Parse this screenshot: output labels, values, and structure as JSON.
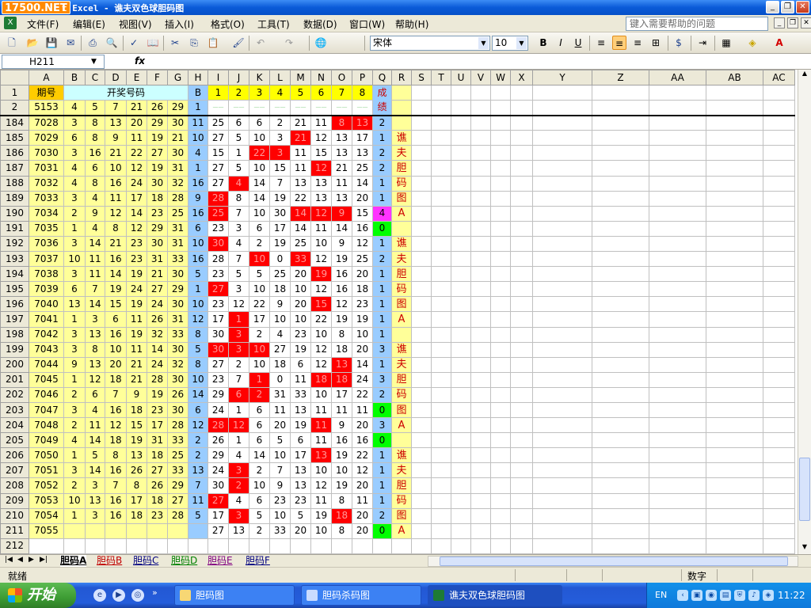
{
  "window": {
    "logo": "17500.NET",
    "title": "t Excel - 谯夫双色球胆码图",
    "controls": [
      "minimize",
      "restore",
      "close"
    ]
  },
  "menu": {
    "items": [
      "文件(F)",
      "编辑(E)",
      "视图(V)",
      "插入(I)",
      "格式(O)",
      "工具(T)",
      "数据(D)",
      "窗口(W)",
      "帮助(H)"
    ],
    "help_placeholder": "键入需要帮助的问题"
  },
  "toolbar": {
    "font_name": "宋体",
    "font_size": "10",
    "bold": "B",
    "italic": "I",
    "underline": "U"
  },
  "formula_bar": {
    "name_box": "H211",
    "fx": "fx",
    "content": ""
  },
  "sheet": {
    "columns": [
      "A",
      "B",
      "C",
      "D",
      "E",
      "F",
      "G",
      "H",
      "I",
      "J",
      "K",
      "L",
      "M",
      "N",
      "O",
      "P",
      "Q",
      "R",
      "S",
      "T",
      "U",
      "V",
      "W",
      "X",
      "Y",
      "Z",
      "AA",
      "AB",
      "AC"
    ],
    "header_row": {
      "row": "1",
      "qihao": "期号",
      "kaijiang": "开奖号码",
      "blue_col": "B",
      "nums": [
        "1",
        "2",
        "3",
        "4",
        "5",
        "6",
        "7",
        "8"
      ],
      "chengji": "成绩"
    },
    "row2": {
      "row": "2",
      "qihao": "5153",
      "balls": [
        "4",
        "5",
        "7",
        "21",
        "26",
        "29"
      ],
      "blue": "1",
      "chengji": "绩"
    },
    "rows": [
      {
        "row": "184",
        "qihao": "7028",
        "balls": [
          "3",
          "8",
          "13",
          "20",
          "29",
          "30"
        ],
        "blue": "11",
        "vals": [
          "25",
          "6",
          "6",
          "2",
          "21",
          "11",
          "8",
          "13"
        ],
        "red": [
          6,
          7
        ],
        "score": "2",
        "score_color": "lb",
        "r": ""
      },
      {
        "row": "185",
        "qihao": "7029",
        "balls": [
          "6",
          "8",
          "9",
          "11",
          "19",
          "21"
        ],
        "blue": "10",
        "vals": [
          "27",
          "5",
          "10",
          "3",
          "21",
          "12",
          "13",
          "17"
        ],
        "red": [
          4
        ],
        "score": "1",
        "score_color": "lb",
        "r": "谯"
      },
      {
        "row": "186",
        "qihao": "7030",
        "balls": [
          "3",
          "16",
          "21",
          "22",
          "27",
          "30"
        ],
        "blue": "4",
        "vals": [
          "15",
          "1",
          "22",
          "3",
          "11",
          "15",
          "13",
          "13"
        ],
        "red": [
          2,
          3
        ],
        "score": "2",
        "score_color": "lb",
        "r": "夫"
      },
      {
        "row": "187",
        "qihao": "7031",
        "balls": [
          "4",
          "6",
          "10",
          "12",
          "19",
          "31"
        ],
        "blue": "1",
        "vals": [
          "27",
          "5",
          "10",
          "15",
          "11",
          "12",
          "21",
          "25"
        ],
        "red": [
          5
        ],
        "score": "2",
        "score_color": "lb",
        "r": "胆"
      },
      {
        "row": "188",
        "qihao": "7032",
        "balls": [
          "4",
          "8",
          "16",
          "24",
          "30",
          "32"
        ],
        "blue": "16",
        "vals": [
          "27",
          "4",
          "14",
          "7",
          "13",
          "13",
          "11",
          "14"
        ],
        "red": [
          1
        ],
        "score": "1",
        "score_color": "lb",
        "r": "码"
      },
      {
        "row": "189",
        "qihao": "7033",
        "balls": [
          "3",
          "4",
          "11",
          "17",
          "18",
          "28"
        ],
        "blue": "9",
        "vals": [
          "28",
          "8",
          "14",
          "19",
          "22",
          "13",
          "13",
          "20"
        ],
        "red": [
          0
        ],
        "score": "1",
        "score_color": "lb",
        "r": "图"
      },
      {
        "row": "190",
        "qihao": "7034",
        "balls": [
          "2",
          "9",
          "12",
          "14",
          "23",
          "25"
        ],
        "blue": "16",
        "vals": [
          "25",
          "7",
          "10",
          "30",
          "14",
          "12",
          "9",
          "15"
        ],
        "red": [
          0,
          4,
          5,
          6
        ],
        "score": "4",
        "score_color": "mag",
        "r": "A"
      },
      {
        "row": "191",
        "qihao": "7035",
        "balls": [
          "1",
          "4",
          "8",
          "12",
          "29",
          "31"
        ],
        "blue": "6",
        "vals": [
          "23",
          "3",
          "6",
          "17",
          "14",
          "11",
          "14",
          "16"
        ],
        "red": [],
        "score": "0",
        "score_color": "grn",
        "r": ""
      },
      {
        "row": "192",
        "qihao": "7036",
        "balls": [
          "3",
          "14",
          "21",
          "23",
          "30",
          "31"
        ],
        "blue": "10",
        "vals": [
          "30",
          "4",
          "2",
          "19",
          "25",
          "10",
          "9",
          "12"
        ],
        "red": [
          0
        ],
        "score": "1",
        "score_color": "lb",
        "r": "谯"
      },
      {
        "row": "193",
        "qihao": "7037",
        "balls": [
          "10",
          "11",
          "16",
          "23",
          "31",
          "33"
        ],
        "blue": "16",
        "vals": [
          "28",
          "7",
          "10",
          "0",
          "33",
          "12",
          "19",
          "25"
        ],
        "red": [
          2,
          4
        ],
        "score": "2",
        "score_color": "lb",
        "r": "夫"
      },
      {
        "row": "194",
        "qihao": "7038",
        "balls": [
          "3",
          "11",
          "14",
          "19",
          "21",
          "30"
        ],
        "blue": "5",
        "vals": [
          "23",
          "5",
          "5",
          "25",
          "20",
          "19",
          "16",
          "20"
        ],
        "red": [
          5
        ],
        "score": "1",
        "score_color": "lb",
        "r": "胆"
      },
      {
        "row": "195",
        "qihao": "7039",
        "balls": [
          "6",
          "7",
          "19",
          "24",
          "27",
          "29"
        ],
        "blue": "1",
        "vals": [
          "27",
          "3",
          "10",
          "18",
          "10",
          "12",
          "16",
          "18"
        ],
        "red": [
          0
        ],
        "score": "1",
        "score_color": "lb",
        "r": "码"
      },
      {
        "row": "196",
        "qihao": "7040",
        "balls": [
          "13",
          "14",
          "15",
          "19",
          "24",
          "30"
        ],
        "blue": "10",
        "vals": [
          "23",
          "12",
          "22",
          "9",
          "20",
          "15",
          "12",
          "23"
        ],
        "red": [
          5
        ],
        "score": "1",
        "score_color": "lb",
        "r": "图"
      },
      {
        "row": "197",
        "qihao": "7041",
        "balls": [
          "1",
          "3",
          "6",
          "11",
          "26",
          "31"
        ],
        "blue": "12",
        "vals": [
          "17",
          "1",
          "17",
          "10",
          "10",
          "22",
          "19",
          "19"
        ],
        "red": [
          1
        ],
        "score": "1",
        "score_color": "lb",
        "r": "A"
      },
      {
        "row": "198",
        "qihao": "7042",
        "balls": [
          "3",
          "13",
          "16",
          "19",
          "32",
          "33"
        ],
        "blue": "8",
        "vals": [
          "30",
          "3",
          "2",
          "4",
          "23",
          "10",
          "8",
          "10"
        ],
        "red": [
          1
        ],
        "score": "1",
        "score_color": "lb",
        "r": ""
      },
      {
        "row": "199",
        "qihao": "7043",
        "balls": [
          "3",
          "8",
          "10",
          "11",
          "14",
          "30"
        ],
        "blue": "5",
        "vals": [
          "30",
          "3",
          "10",
          "27",
          "19",
          "12",
          "18",
          "20"
        ],
        "red": [
          0,
          1,
          2
        ],
        "score": "3",
        "score_color": "lb",
        "r": "谯"
      },
      {
        "row": "200",
        "qihao": "7044",
        "balls": [
          "9",
          "13",
          "20",
          "21",
          "24",
          "32"
        ],
        "blue": "8",
        "vals": [
          "27",
          "2",
          "10",
          "18",
          "6",
          "12",
          "13",
          "14"
        ],
        "red": [
          6
        ],
        "score": "1",
        "score_color": "lb",
        "r": "夫"
      },
      {
        "row": "201",
        "qihao": "7045",
        "balls": [
          "1",
          "12",
          "18",
          "21",
          "28",
          "30"
        ],
        "blue": "10",
        "vals": [
          "23",
          "7",
          "1",
          "0",
          "11",
          "18",
          "18",
          "24"
        ],
        "red": [
          2,
          5,
          6
        ],
        "score": "3",
        "score_color": "lb",
        "r": "胆"
      },
      {
        "row": "202",
        "qihao": "7046",
        "balls": [
          "2",
          "6",
          "7",
          "9",
          "19",
          "26"
        ],
        "blue": "14",
        "vals": [
          "29",
          "6",
          "2",
          "31",
          "33",
          "10",
          "17",
          "22"
        ],
        "red": [
          1,
          2
        ],
        "score": "2",
        "score_color": "lb",
        "r": "码"
      },
      {
        "row": "203",
        "qihao": "7047",
        "balls": [
          "3",
          "4",
          "16",
          "18",
          "23",
          "30"
        ],
        "blue": "6",
        "vals": [
          "24",
          "1",
          "6",
          "11",
          "13",
          "11",
          "11",
          "11"
        ],
        "red": [],
        "score": "0",
        "score_color": "grn",
        "r": "图"
      },
      {
        "row": "204",
        "qihao": "7048",
        "balls": [
          "2",
          "11",
          "12",
          "15",
          "17",
          "28"
        ],
        "blue": "12",
        "vals": [
          "28",
          "12",
          "6",
          "20",
          "19",
          "11",
          "9",
          "20"
        ],
        "red": [
          0,
          1,
          5
        ],
        "score": "3",
        "score_color": "lb",
        "r": "A"
      },
      {
        "row": "205",
        "qihao": "7049",
        "balls": [
          "4",
          "14",
          "18",
          "19",
          "31",
          "33"
        ],
        "blue": "2",
        "vals": [
          "26",
          "1",
          "6",
          "5",
          "6",
          "11",
          "16",
          "16"
        ],
        "red": [],
        "score": "0",
        "score_color": "grn",
        "r": ""
      },
      {
        "row": "206",
        "qihao": "7050",
        "balls": [
          "1",
          "5",
          "8",
          "13",
          "18",
          "25"
        ],
        "blue": "2",
        "vals": [
          "29",
          "4",
          "14",
          "10",
          "17",
          "13",
          "19",
          "22"
        ],
        "red": [
          5
        ],
        "score": "1",
        "score_color": "lb",
        "r": "谯"
      },
      {
        "row": "207",
        "qihao": "7051",
        "balls": [
          "3",
          "14",
          "16",
          "26",
          "27",
          "33"
        ],
        "blue": "13",
        "vals": [
          "24",
          "3",
          "2",
          "7",
          "13",
          "10",
          "10",
          "12"
        ],
        "red": [
          1
        ],
        "score": "1",
        "score_color": "lb",
        "r": "夫"
      },
      {
        "row": "208",
        "qihao": "7052",
        "balls": [
          "2",
          "3",
          "7",
          "8",
          "26",
          "29"
        ],
        "blue": "7",
        "vals": [
          "30",
          "2",
          "10",
          "9",
          "13",
          "12",
          "19",
          "20"
        ],
        "red": [
          1
        ],
        "score": "1",
        "score_color": "lb",
        "r": "胆"
      },
      {
        "row": "209",
        "qihao": "7053",
        "balls": [
          "10",
          "13",
          "16",
          "17",
          "18",
          "27"
        ],
        "blue": "11",
        "vals": [
          "27",
          "4",
          "6",
          "23",
          "23",
          "11",
          "8",
          "11"
        ],
        "red": [
          0
        ],
        "score": "1",
        "score_color": "lb",
        "r": "码"
      },
      {
        "row": "210",
        "qihao": "7054",
        "balls": [
          "1",
          "3",
          "16",
          "18",
          "23",
          "28"
        ],
        "blue": "5",
        "vals": [
          "17",
          "3",
          "5",
          "10",
          "5",
          "19",
          "18",
          "20"
        ],
        "red": [
          1,
          6
        ],
        "score": "2",
        "score_color": "lb",
        "r": "图"
      },
      {
        "row": "211",
        "qihao": "7055",
        "balls": [
          "",
          "",
          "",
          "",
          "",
          ""
        ],
        "blue": "",
        "vals": [
          "27",
          "13",
          "2",
          "33",
          "20",
          "10",
          "8",
          "20"
        ],
        "red": [],
        "score": "0",
        "score_color": "grn",
        "r": "A"
      },
      {
        "row": "212",
        "qihao": "",
        "balls": [
          "",
          "",
          "",
          "",
          "",
          ""
        ],
        "blue": "",
        "vals": [
          "",
          "",
          "",
          "",
          "",
          "",
          "",
          ""
        ],
        "red": [],
        "score": "",
        "score_color": "",
        "r": ""
      }
    ]
  },
  "sheet_tabs": [
    "胆码A",
    "胆码B",
    "胆码C",
    "胆码D",
    "胆码E",
    "胆码F"
  ],
  "status": {
    "ready": "就绪",
    "mode": "数字"
  },
  "taskbar": {
    "start": "开始",
    "items": [
      "胆码图",
      "胆码杀码图",
      "谯夫双色球胆码图"
    ],
    "lang": "EN",
    "clock": "11:22"
  }
}
